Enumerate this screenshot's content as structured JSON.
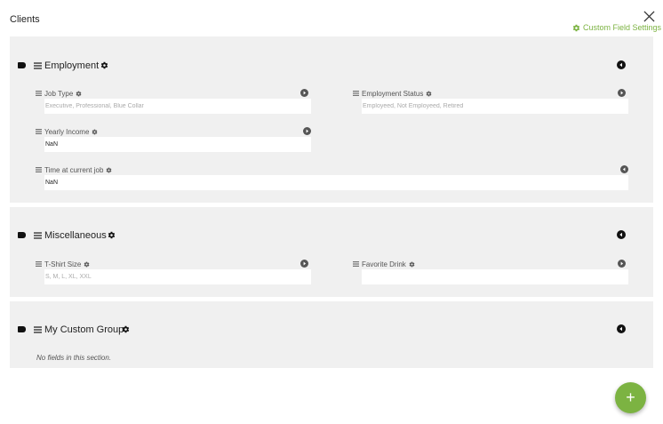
{
  "header": {
    "title": "Clients",
    "custom_field_settings_label": "Custom Field Settings"
  },
  "colors": {
    "accent": "#7cb342",
    "section_bg": "#f0f0f0",
    "icon": "#111111"
  },
  "sections": [
    {
      "title": "Employment",
      "fields": [
        {
          "label": "Job Type",
          "value": "",
          "placeholder": "Executive, Professional, Blue Collar"
        },
        {
          "label": "Employment Status",
          "value": "",
          "placeholder": "Employeed, Not Employeed, Retired"
        },
        {
          "label": "Yearly Income",
          "value": "NaN",
          "placeholder": ""
        },
        {
          "label": "Time at current job",
          "value": "NaN",
          "placeholder": ""
        }
      ]
    },
    {
      "title": "Miscellaneous",
      "fields": [
        {
          "label": "T-Shirt Size",
          "value": "",
          "placeholder": "S, M, L, XL, XXL"
        },
        {
          "label": "Favorite Drink",
          "value": "",
          "placeholder": ""
        }
      ]
    },
    {
      "title": "My Custom Group",
      "empty_message": "No fields in this section."
    }
  ],
  "fab": {
    "label": "+"
  },
  "icons": [
    "close-icon",
    "gear-icon",
    "menu-icon",
    "tag-icon",
    "circle-arrow-icon",
    "plus-icon"
  ]
}
